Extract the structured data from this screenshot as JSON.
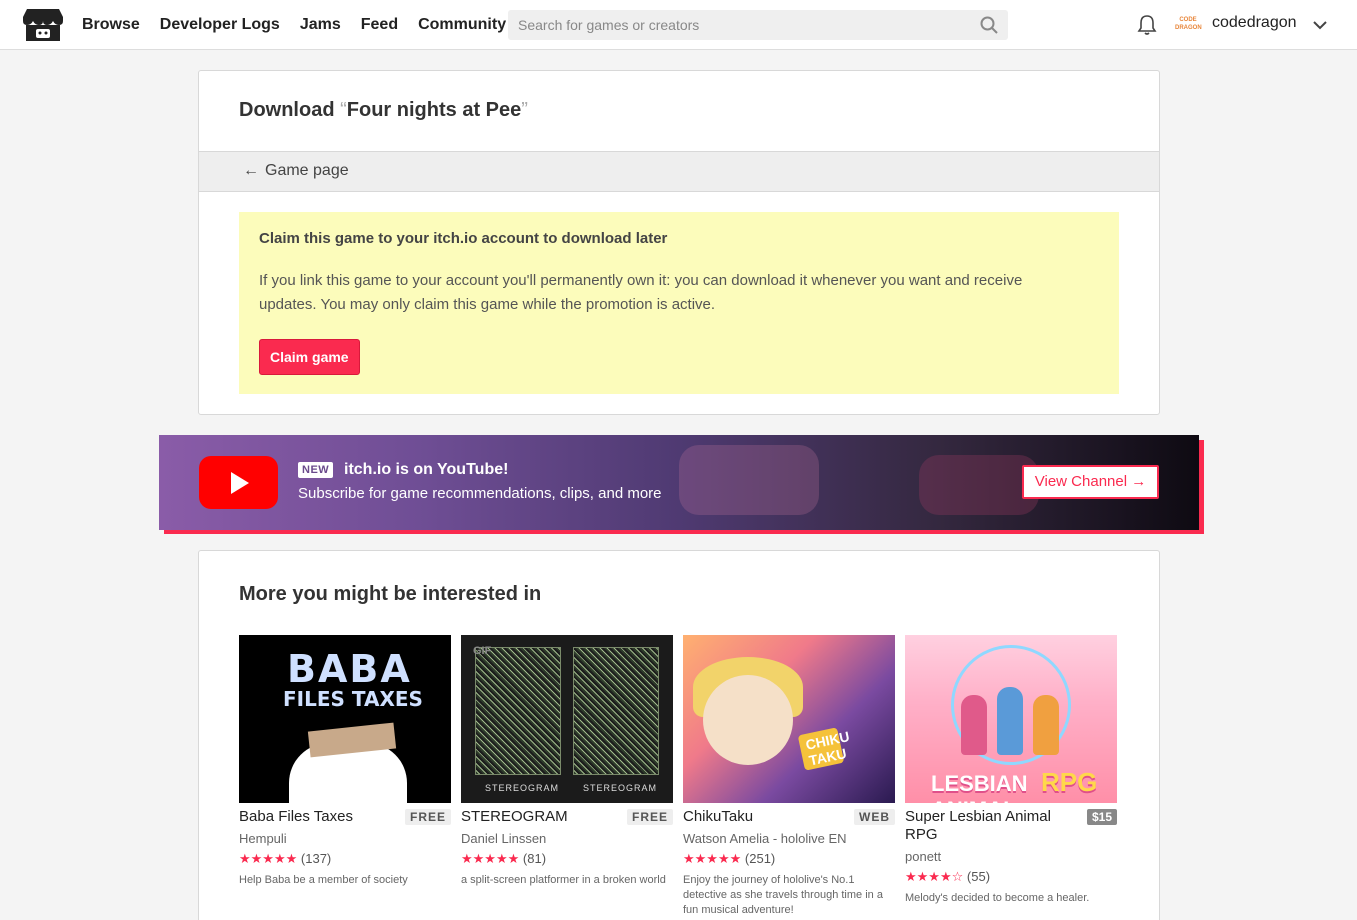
{
  "header": {
    "nav": [
      "Browse",
      "Developer Logs",
      "Jams",
      "Feed",
      "Community"
    ],
    "search_placeholder": "Search for games or creators",
    "username": "codedragon",
    "avatar_text": "CODE DRAGON"
  },
  "download": {
    "title_prefix": "Download ",
    "quote_open": "“",
    "game_name": "Four nights at Pee",
    "quote_close": "”",
    "back_arrow": "←",
    "back_label": "Game page",
    "claim_heading": "Claim this game to your itch.io account to download later",
    "claim_text": "If you link this game to your account you'll permanently own it: you can download it whenever you want and receive updates. You may only claim this game while the promotion is active.",
    "claim_button": "Claim game"
  },
  "youtube_banner": {
    "badge": "NEW",
    "title": "itch.io is on YouTube!",
    "subtitle": "Subscribe for game recommendations, clips, and more",
    "button": "View Channel →"
  },
  "recommendations": {
    "title": "More you might be interested in",
    "games": [
      {
        "name": "Baba Files Taxes",
        "tag": "FREE",
        "author": "Hempuli",
        "stars": "★★★★★",
        "rating_count": "(137)",
        "description": "Help Baba be a member of society",
        "thumb_text_1": "BABA",
        "thumb_text_2": "FILES TAXES"
      },
      {
        "name": "STEREOGRAM",
        "tag": "FREE",
        "author": "Daniel Linssen",
        "stars": "★★★★★",
        "rating_count": "(81)",
        "description": "a split-screen platformer in a broken world",
        "gif_badge": "GIF",
        "thumb_label_left": "STEREOGRAM",
        "thumb_label_right": "STEREOGRAM"
      },
      {
        "name": "ChikuTaku",
        "tag": "WEB",
        "author": "Watson Amelia - hololive EN",
        "stars": "★★★★★",
        "rating_count": "(251)",
        "description": "Enjoy the journey of hololive's No.1 detective as she travels through time in a fun musical adventure!",
        "thumb_logo": "CHIKU TAKU"
      },
      {
        "name": "Super Lesbian Animal RPG",
        "tag": "$15",
        "author": "ponett",
        "stars": "★★★★☆",
        "rating_count": "(55)",
        "description": "Melody's decided to become a healer.",
        "thumb_word_1": "LESBIAN ANIMAL",
        "thumb_word_2": "RPG"
      }
    ]
  }
}
